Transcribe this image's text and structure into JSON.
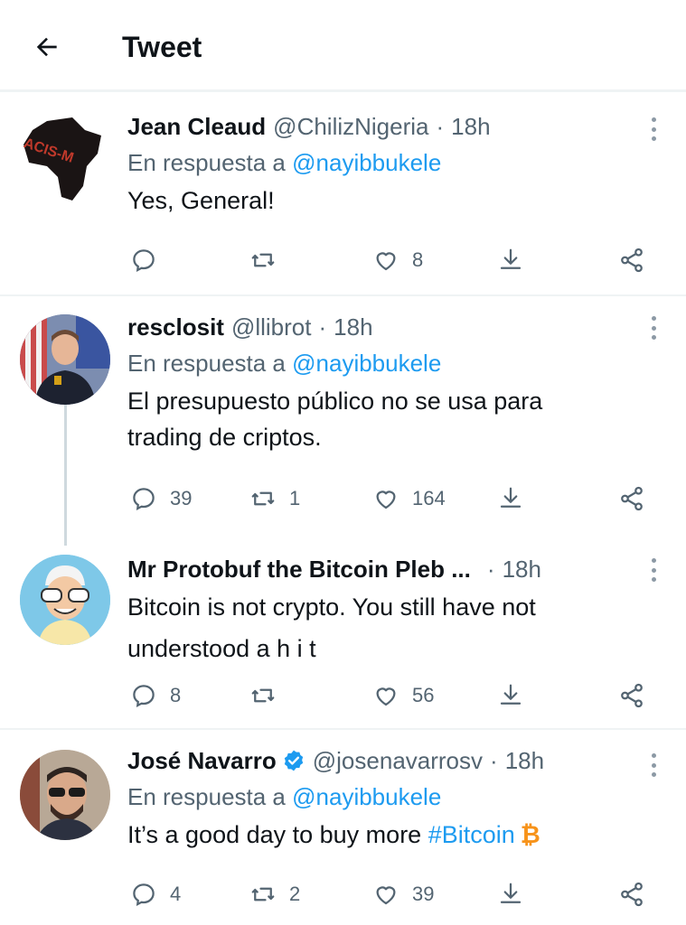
{
  "header": {
    "title": "Tweet",
    "back_icon": "arrow-left-icon"
  },
  "tweets": [
    {
      "name": "Jean Cleaud",
      "handle": "@ChilizNigeria",
      "time": "18h",
      "reply_prefix": "En respuesta a",
      "reply_to": "@nayibbukele",
      "text": "Yes, General!",
      "replies": "",
      "retweets": "",
      "likes": "8",
      "avatar_text": "ACIS-M"
    },
    {
      "name": "resclosit",
      "handle": "@llibrot",
      "time": "18h",
      "reply_prefix": "En respuesta a",
      "reply_to": "@nayibbukele",
      "text_lines": [
        "El presupuesto público no se usa para",
        "trading de criptos."
      ],
      "replies": "39",
      "retweets": "1",
      "likes": "164"
    },
    {
      "name": "Mr Protobuf the Bitcoin Pleb ...",
      "time": "18h",
      "text_lines": [
        "Bitcoin is not crypto. You still have not",
        "understood a h i t"
      ],
      "replies": "8",
      "retweets": "",
      "likes": "56"
    },
    {
      "name": "José Navarro",
      "handle": "@josenavarrosv",
      "time": "18h",
      "reply_prefix": "En respuesta a",
      "reply_to": "@nayibbukele",
      "text_before": "It’s a good day to buy more ",
      "hashtag": "#Bitcoin",
      "emoji": "₿",
      "replies": "4",
      "retweets": "2",
      "likes": "39"
    }
  ],
  "colors": {
    "accent": "#1d9bf0",
    "secondary": "#536471",
    "verified": "#1d9bf0"
  },
  "icons": [
    "reply-icon",
    "retweet-icon",
    "like-icon",
    "share-icon",
    "bookmark-share-icon",
    "more-icon",
    "verified-badge-icon"
  ]
}
